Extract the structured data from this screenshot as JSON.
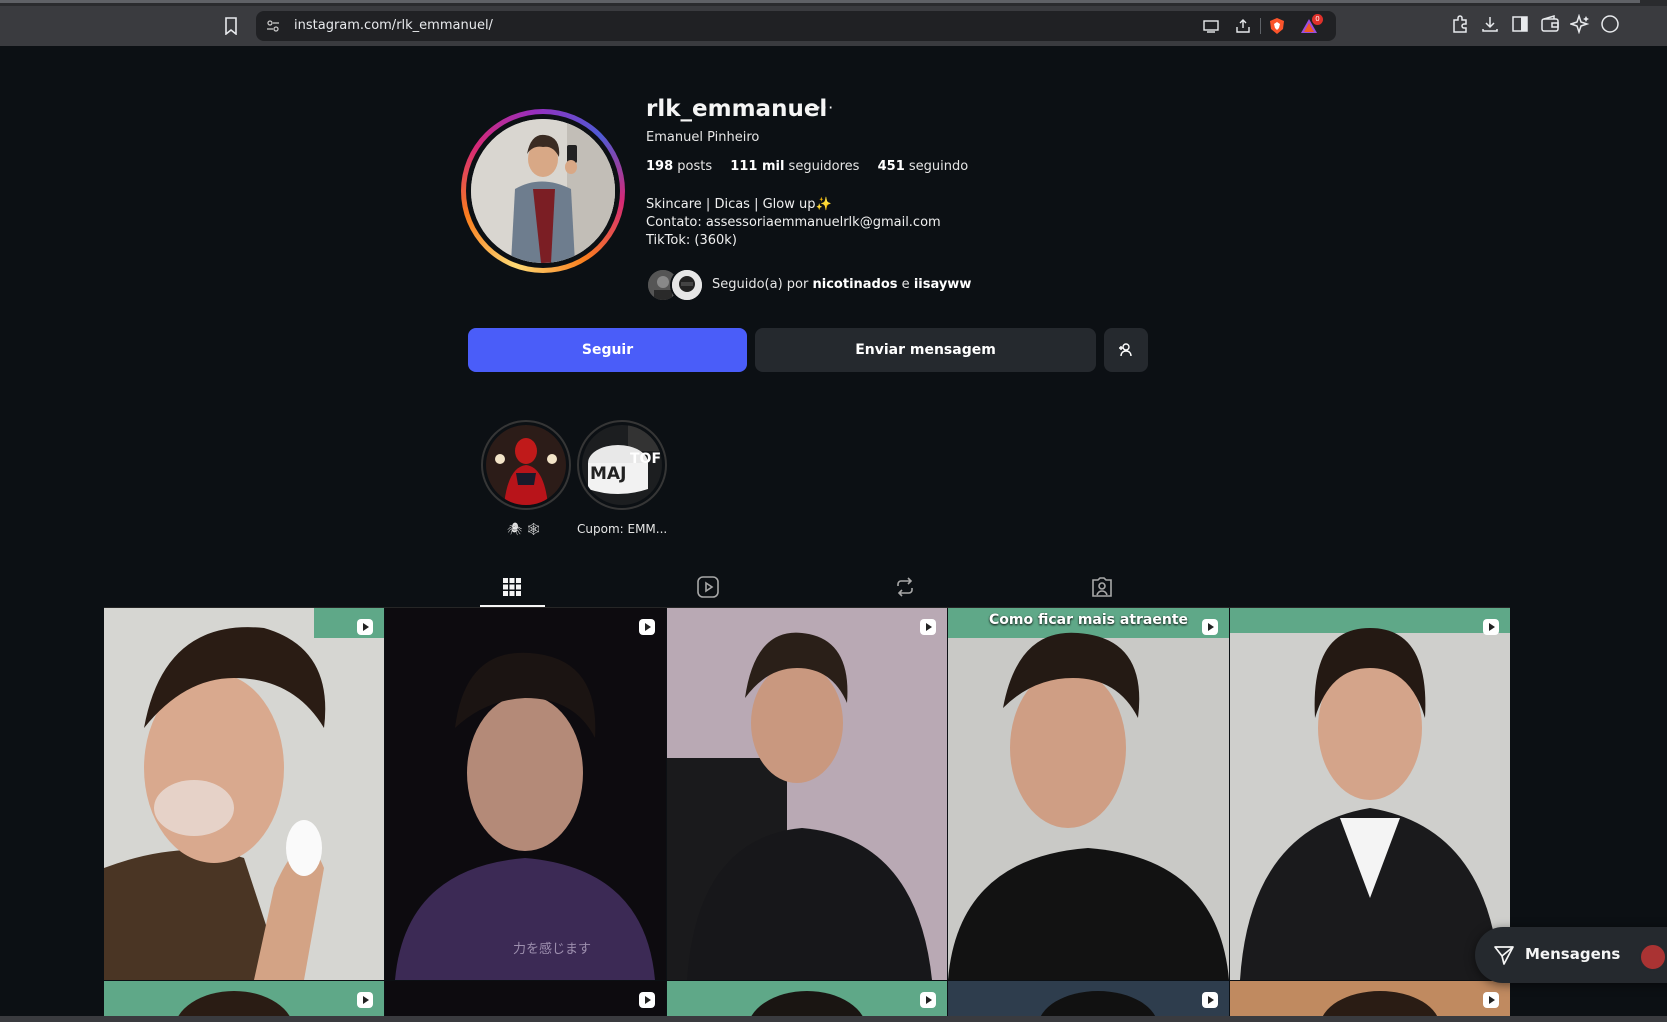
{
  "browser": {
    "url": "instagram.com/rlk_emmanuel/",
    "brave_badge_count": "0"
  },
  "profile": {
    "username": "rlk_emmanuel",
    "full_name": "Emanuel Pinheiro",
    "stats": [
      {
        "value": "198",
        "label": "posts"
      },
      {
        "value": "111 mil",
        "label": "seguidores"
      },
      {
        "value": "451",
        "label": "seguindo"
      }
    ],
    "bio_line1": "Skincare | Dicas | Glow up",
    "bio_line2": "Contato: assessoriaemmanuelrlk@gmail.com",
    "bio_line3": "TikTok: (360k)",
    "followed_by_prefix": "Seguido(a) por",
    "followed_by_user1": "nicotinados",
    "followed_by_join": "e",
    "followed_by_user2": "iisayww"
  },
  "actions": {
    "follow_label": "Seguir",
    "message_label": "Enviar mensagem"
  },
  "highlights": [
    {
      "label": "🕷 🕸"
    },
    {
      "label": "Cupom: EMM..."
    }
  ],
  "tabs": [
    "posts-grid",
    "reels",
    "reposts",
    "tagged"
  ],
  "posts": [
    {
      "caption": ""
    },
    {
      "caption": ""
    },
    {
      "caption": ""
    },
    {
      "caption": "Como ficar mais atraente"
    },
    {
      "caption": ""
    }
  ],
  "messages_pill": {
    "label": "Mensagens"
  },
  "colors": {
    "background": "#0c1014",
    "follow_button": "#4a5df9",
    "secondary_button": "#25292e"
  }
}
